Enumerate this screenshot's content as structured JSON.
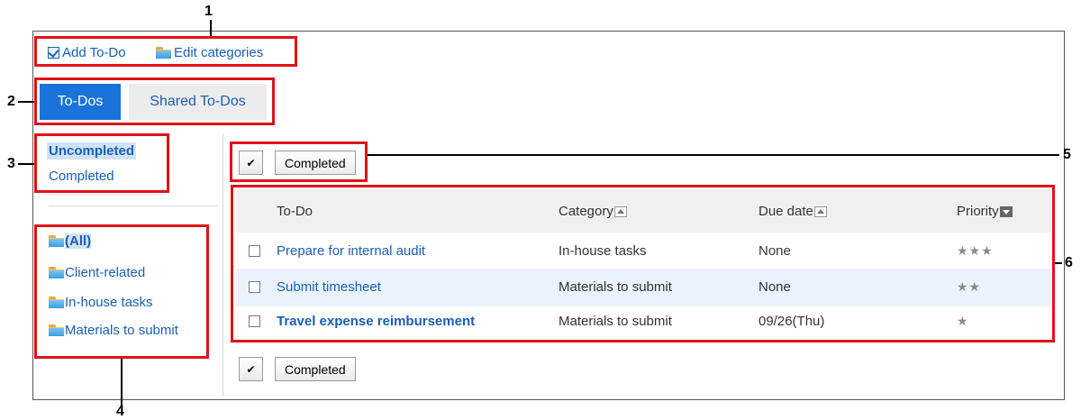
{
  "callouts": [
    "1",
    "2",
    "3",
    "4",
    "5",
    "6"
  ],
  "toolbar": {
    "add_todo": "Add To-Do",
    "edit_categories": "Edit categories"
  },
  "tabs": [
    {
      "label": "To-Dos",
      "active": true
    },
    {
      "label": "Shared To-Dos",
      "active": false
    }
  ],
  "status_filter": {
    "items": [
      "Uncompleted",
      "Completed"
    ],
    "selected": "Uncompleted"
  },
  "categories": {
    "items": [
      "(All)",
      "Client-related",
      "In-house tasks",
      "Materials to submit"
    ],
    "selected": "(All)"
  },
  "actions": {
    "check_all_symbol": "✔",
    "completed_button": "Completed"
  },
  "table": {
    "headers": [
      "To-Do",
      "Category",
      "Due date",
      "Priority"
    ],
    "rows": [
      {
        "todo": "Prepare for internal audit",
        "category": "In-house tasks",
        "due": "None",
        "priority": "★★★",
        "bold": false
      },
      {
        "todo": "Submit timesheet",
        "category": "Materials to submit",
        "due": "None",
        "priority": "★★",
        "bold": false
      },
      {
        "todo": "Travel expense reimbursement",
        "category": "Materials to submit",
        "due": "09/26(Thu)",
        "priority": "★",
        "bold": true
      }
    ]
  },
  "colors": {
    "accent": "#1a73d9",
    "link": "#1a5fb4",
    "callout_border": "#e0121a",
    "row_highlight": "#eaf3fb",
    "header_bg": "#f0f0f0"
  }
}
